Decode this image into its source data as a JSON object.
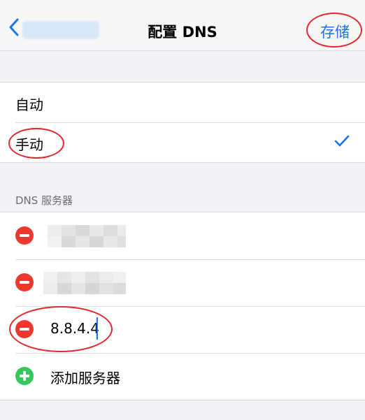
{
  "nav": {
    "title": "配置 DNS",
    "save_label": "存储"
  },
  "mode": {
    "options": [
      {
        "label": "自动",
        "selected": false
      },
      {
        "label": "手动",
        "selected": true
      }
    ]
  },
  "dns_section": {
    "header": "DNS 服务器",
    "servers": [
      {
        "value": "",
        "obscured": true
      },
      {
        "value": "",
        "obscured": true
      },
      {
        "value": "8.8.4.4",
        "obscured": false,
        "editing": true
      }
    ],
    "add_label": "添加服务器"
  },
  "colors": {
    "accent": "#1a73e8",
    "delete": "#f0372e",
    "add": "#34c759",
    "annotation": "#e0282e"
  }
}
